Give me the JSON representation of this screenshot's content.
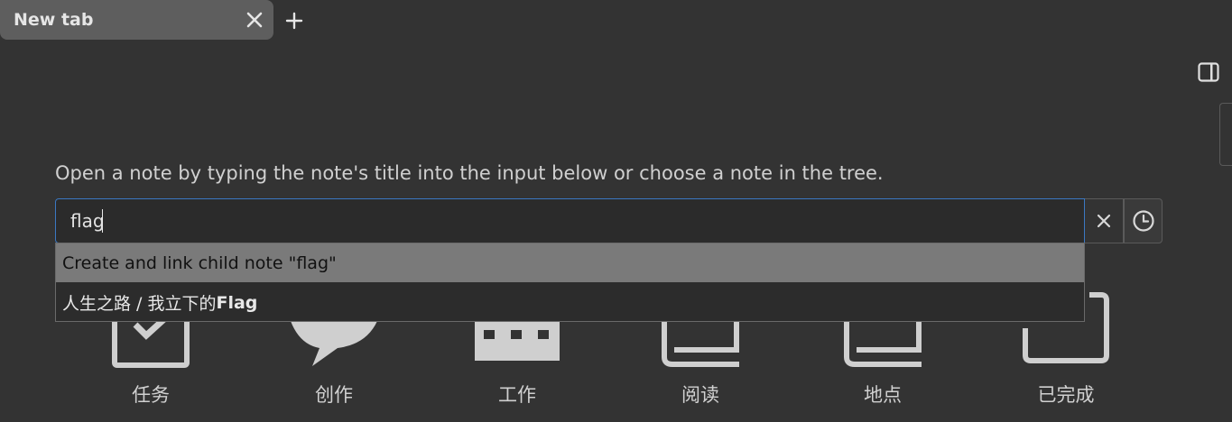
{
  "tabs": [
    {
      "label": "New tab"
    }
  ],
  "hint": "Open a note by typing the note's title into the input below or choose a note in the tree.",
  "search": {
    "value": "flag",
    "clear_icon": "close-icon",
    "history_icon": "clock-icon"
  },
  "dropdown": {
    "create_label": "Create and link child note \"flag\"",
    "result_path": "人生之路 / 我立下的",
    "result_match": "Flag"
  },
  "grid": [
    {
      "label": "任务",
      "icon": "checkbox-icon"
    },
    {
      "label": "创作",
      "icon": "speech-bubble-icon"
    },
    {
      "label": "工作",
      "icon": "calendar-icon"
    },
    {
      "label": "阅读",
      "icon": "book-icon"
    },
    {
      "label": "地点",
      "icon": "book-icon"
    },
    {
      "label": "已完成",
      "icon": "square-icon"
    }
  ],
  "colors": {
    "background": "#333333",
    "tab": "#5e5e5e",
    "focus_border": "#3b78c2",
    "dropdown_active": "#7a7a7a"
  }
}
